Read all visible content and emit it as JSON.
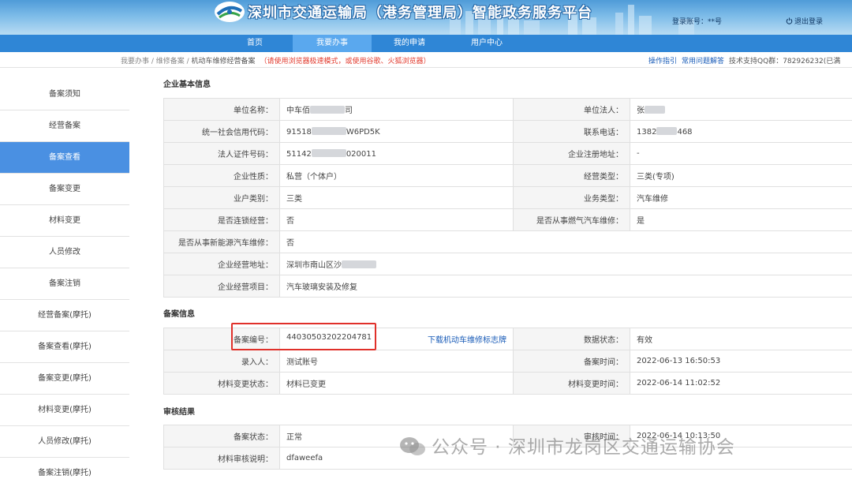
{
  "header": {
    "title": "深圳市交通运输局（港务管理局）智能政务服务平台",
    "account_label": "登录账号：**号",
    "logout_label": "退出登录"
  },
  "nav": {
    "items": [
      {
        "label": "首页"
      },
      {
        "label": "我要办事"
      },
      {
        "label": "我的申请"
      },
      {
        "label": "用户中心"
      }
    ],
    "active": "我要办事"
  },
  "breadcrumb": {
    "path": "我要办事 / 维修备案 / ",
    "current": "机动车维修经营备案",
    "warning": "（请使用浏览器极速模式，或使用谷歌、火狐浏览器）"
  },
  "toplinks": {
    "guide": "操作指引",
    "faq": "常用问题解答",
    "support": "技术支持QQ群：782926232(已满"
  },
  "sidebar": {
    "items": [
      {
        "label": "备案须知"
      },
      {
        "label": "经营备案"
      },
      {
        "label": "备案查看"
      },
      {
        "label": "备案变更"
      },
      {
        "label": "材料变更"
      },
      {
        "label": "人员修改"
      },
      {
        "label": "备案注销"
      },
      {
        "label": "经营备案(摩托)"
      },
      {
        "label": "备案查看(摩托)"
      },
      {
        "label": "备案变更(摩托)"
      },
      {
        "label": "材料变更(摩托)"
      },
      {
        "label": "人员修改(摩托)"
      },
      {
        "label": "备案注销(摩托)"
      }
    ],
    "active": "备案查看"
  },
  "company": {
    "section_title": "企业基本信息",
    "unit_name_label": "单位名称：",
    "unit_name_a": "中车佰",
    "unit_name_b": "司",
    "legal_person_label": "单位法人：",
    "legal_person_a": "张",
    "credit_code_label": "统一社会信用代码：",
    "credit_code_a": "91518",
    "credit_code_b": "W6PD5K",
    "phone_label": "联系电话：",
    "phone_a": "1382",
    "phone_b": "468",
    "id_no_label": "法人证件号码：",
    "id_no_a": "51142",
    "id_no_b": "020011",
    "reg_addr_label": "企业注册地址：",
    "reg_addr": "-",
    "nature_label": "企业性质：",
    "nature": "私营（个体户）",
    "biz_type_label": "经营类型：",
    "biz_type": "三类(专项)",
    "category_label": "业户类别：",
    "category": "三类",
    "service_type_label": "业务类型：",
    "service_type": "汽车维修",
    "chain_label": "是否连锁经营：",
    "chain": "否",
    "gas_label": "是否从事燃气汽车维修：",
    "gas": "是",
    "ev_label": "是否从事新能源汽车维修：",
    "ev": "否",
    "address_label": "企业经营地址：",
    "address_a": "深圳市南山区沙",
    "scope_label": "企业经营项目：",
    "scope": "汽车玻璃安装及修复"
  },
  "record": {
    "section_title": "备案信息",
    "number_label": "备案编号：",
    "number": "44030503202204781",
    "download_link": "下载机动车维修标志牌",
    "data_status_label": "数据状态：",
    "data_status": "有效",
    "entrant_label": "录入人：",
    "entrant": "测试账号",
    "record_time_label": "备案时间：",
    "record_time": "2022-06-13 16:50:53",
    "mat_status_label": "材料变更状态：",
    "mat_status": "材料已变更",
    "mat_time_label": "材料变更时间：",
    "mat_time": "2022-06-14 11:02:52"
  },
  "audit": {
    "section_title": "审核结果",
    "status_label": "备案状态：",
    "status": "正常",
    "time_label": "审核时间：",
    "time": "2022-06-14 10:13:50",
    "note_label": "材料审核说明：",
    "note": "dfaweefa"
  },
  "watermark": {
    "text": "公众号 · 深圳市龙岗区交通运输协会"
  },
  "colors": {
    "nav_bg": "#2f86d6",
    "nav_active": "#5aa8ee",
    "sidebar_active": "#4a90e2",
    "status_ok": "#2fb043",
    "status_normal": "#f0a020",
    "warning_red": "#e23b2e",
    "highlight_box": "#e0302a"
  }
}
